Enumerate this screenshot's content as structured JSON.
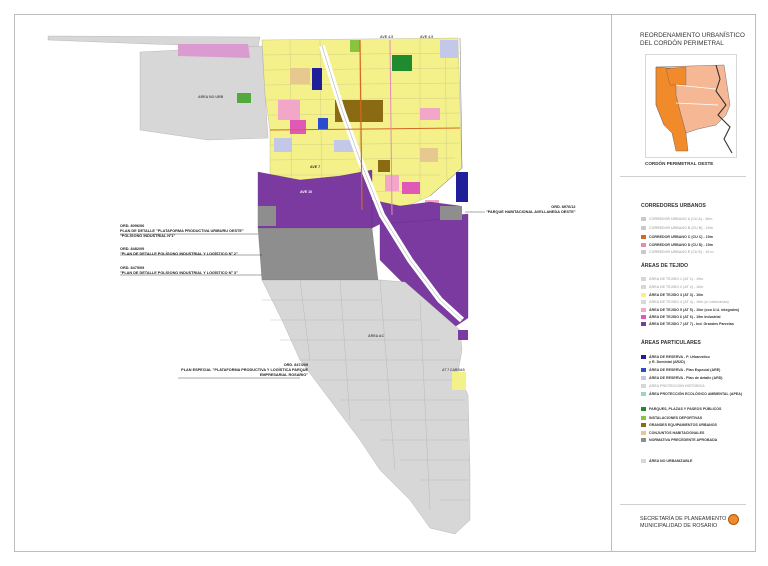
{
  "title": {
    "line1": "REORDENAMIENTO URBANÍSTICO",
    "line2": "DEL CORDÓN PERIMETRAL"
  },
  "locator_caption": "CORDÓN PERIMETRAL OESTE",
  "map_labels": {
    "ave_top": "AVE 4.5",
    "ave_top2": "AVE 4.5",
    "ave_mid": "AVE 10",
    "ave_mid2": "AVE 7",
    "area_west": "AREA NO URB",
    "area_south": "ÁREA AC",
    "area_sw_small": "AT 7 CARGAS"
  },
  "annotations": {
    "ord_8976": {
      "line1": "ORD. 8976/12",
      "line2": "\"PARQUE HABITACIONAL AVELLANEDA OESTE\""
    },
    "ord_8096": {
      "line1": "ORD. 8096/06",
      "line2": "PLAN DE DETALLE \"PLATAFORMA PRODUCTIVA URIBURU OESTE\"",
      "line3": "\"POLÍGONO INDUSTRIAL Nº1\""
    },
    "ord_8482": {
      "line1": "ORD. 8482/09",
      "line2": "\"PLAN DE DETALLE POLÍGONO INDUSTRIAL Y LOGÍSTICO Nº 2\""
    },
    "ord_8475": {
      "line1": "ORD. 8475/09",
      "line2": "\"PLAN DE DETALLE POLÍGONO INDUSTRIAL Y LOGÍSTICO Nº 3\""
    },
    "ord_8474": {
      "line1": "ORD. 8474/09",
      "line2": "PLAN ESPECIAL \"PLATAFORMA PRODUCTIVA Y LOGÍSTICA PARQUE",
      "line3": "EMPRESARIAL ROSARIO\""
    }
  },
  "legend": {
    "corredores": {
      "title": "CORREDORES URBANOS",
      "items": [
        {
          "label": "CORREDOR URBANO A (CU A) - 36m",
          "color": "#c9c9c9",
          "faded": true
        },
        {
          "label": "CORREDOR URBANO B (CU B) - 19m",
          "color": "#c9c9c9",
          "faded": true
        },
        {
          "label": "CORREDOR URBANO C (CU C) - 19m",
          "color": "#d2691e",
          "faded": false
        },
        {
          "label": "CORREDOR URBANO D (CU D) - 19m",
          "color": "#e58bb5",
          "faded": false
        },
        {
          "label": "CORREDOR URBANO E (CU E) - 19 m",
          "color": "#c9c9c9",
          "faded": true
        }
      ]
    },
    "areas_tejido": {
      "title": "ÁREAS DE TEJIDO",
      "items": [
        {
          "label": "ÁREA DE TEJIDO 1 (AT 1) - 19m",
          "color": "#d7d7d7",
          "faded": true
        },
        {
          "label": "ÁREA DE TEJIDO 2 (AT 2) - 16m",
          "color": "#d7d7d7",
          "faded": true
        },
        {
          "label": "ÁREA DE TEJIDO 3 (AT 3) - 10m",
          "color": "#f4f18a",
          "faded": false
        },
        {
          "label": "ÁREA DE TEJIDO 4 (AT 4) - 10m (c/ ordenanza)",
          "color": "#d7d7d7",
          "faded": true
        },
        {
          "label": "ÁREA DE TEJIDO 5 (AT 5) - 10m (con U.U. integrales)",
          "color": "#f2a7c8",
          "faded": false
        },
        {
          "label": "ÁREA DE TEJIDO 6 (AT 6) - 19m Industrial",
          "color": "#e059b7",
          "faded": false
        },
        {
          "label": "ÁREA DE TEJIDO 7 (AT 7) - Ind. Grandes Parcelas",
          "color": "#7b3aa0",
          "faded": false
        }
      ]
    },
    "areas_particulares": {
      "title": "ÁREAS PARTICULARES",
      "items": [
        {
          "label": "ÁREA DE RESERVA - P. Urbanístico",
          "label2": "y R. Dominial (AR2D)",
          "color": "#1f1f9a",
          "faded": false
        },
        {
          "label": "ÁREA DE RESERVA - Plan Especial (ARE)",
          "color": "#2b4ccc",
          "faded": false
        },
        {
          "label": "ÁREA DE RESERVA - Plan de detalle (ARD)",
          "color": "#c3c7e8",
          "faded": false
        },
        {
          "label": "ÁREA PROTECCIÓN HISTÓRICA",
          "color": "#d7d7d7",
          "faded": true
        },
        {
          "label": "ÁREA PROTECCIÓN ECOLÓGICO AMBIENTAL (APEA)",
          "color": "#9bd7b6",
          "faded": false
        },
        {
          "label": "PARQUES, PLAZAS Y PASEOS PÚBLICOS",
          "color": "#1f8a2e",
          "faded": false
        },
        {
          "label": "INSTALACIONES DEPORTIVAS",
          "color": "#8ac33e",
          "faded": false
        },
        {
          "label": "GRANDES EQUIPAMIENTOS URBANOS",
          "color": "#8a6a12",
          "faded": false
        },
        {
          "label": "CONJUNTOS HABITACIONALES",
          "color": "#e7c98f",
          "faded": false
        },
        {
          "label": "NORMATIVA PRECEDENTE APROBADA",
          "color": "#8e8e8e",
          "faded": false
        },
        {
          "label": "ÁREA NO URBANIZABLE",
          "color": "#d7d7d7",
          "faded": false
        }
      ]
    }
  },
  "footer": {
    "line1": "SECRETARÍA DE PLANEAMIENTO",
    "line2": "MUNICIPALIDAD DE ROSARIO"
  },
  "colors": {
    "no_urbanizable": "#d7d7d7",
    "at7": "#7b3aa0",
    "normativa": "#8e8e8e",
    "at3": "#f4f18a",
    "locator_highlight": "#f08a2a",
    "locator_base": "#f6b894"
  }
}
